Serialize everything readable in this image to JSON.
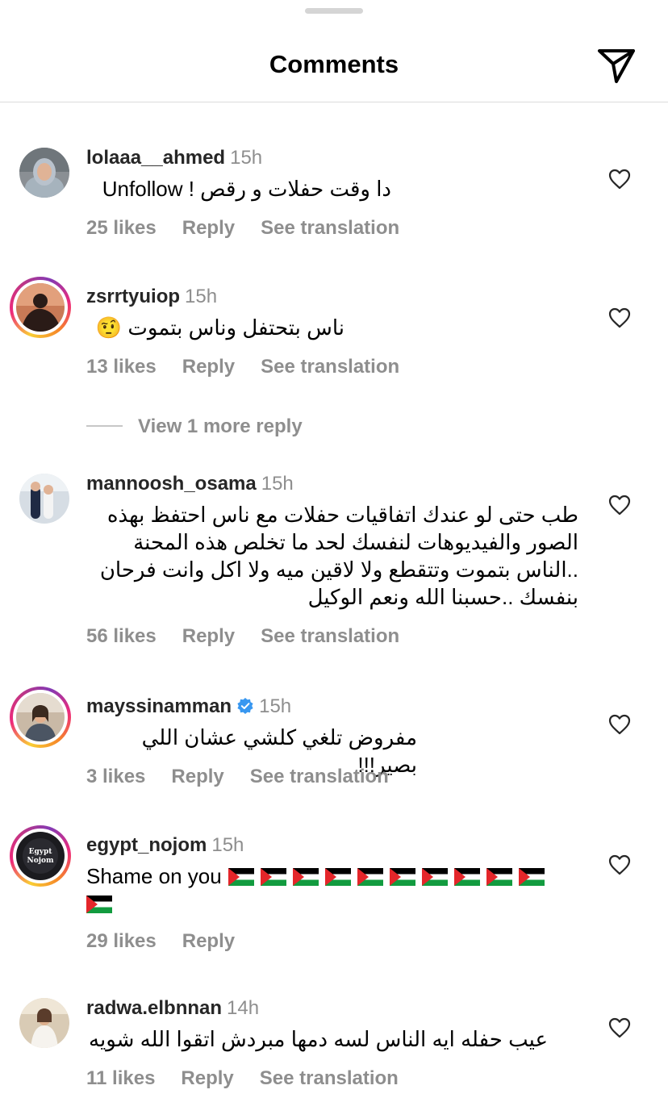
{
  "header": {
    "title": "Comments"
  },
  "comments": [
    {
      "username": "lolaaa__ahmed",
      "time": "15h",
      "text": "دا وقت حفلات و رقص ! Unfollow",
      "likes": "25 likes",
      "reply": "Reply",
      "translate": "See translation"
    },
    {
      "username": "zsrrtyuiop",
      "time": "15h",
      "text": "ناس بتحتفل وناس بتموت 🤨",
      "likes": "13 likes",
      "reply": "Reply",
      "translate": "See translation"
    },
    {
      "username": "mannoosh_osama",
      "time": "15h",
      "text": "طب حتى لو عندك اتفاقيات حفلات مع ناس احتفظ بهذه الصور والفيديوهات لنفسك لحد ما تخلص هذه المحنة ..الناس بتموت وتتقطع ولا لاقين ميه ولا اكل وانت فرحان بنفسك ..حسبنا الله ونعم الوكيل",
      "likes": "56 likes",
      "reply": "Reply",
      "translate": "See translation"
    },
    {
      "username": "mayssinamman",
      "time": "15h",
      "text": "مفروض تلغي كلشي عشان اللي بصير!!!",
      "likes": "3 likes",
      "reply": "Reply",
      "translate": "See translation"
    },
    {
      "username": "egypt_nojom",
      "time": "15h",
      "text": "Shame on you",
      "likes": "29 likes",
      "reply": "Reply"
    },
    {
      "username": "radwa.elbnnan",
      "time": "14h",
      "text": "عيب حفله ايه الناس لسه دمها مبردش اتقوا الله شويه",
      "likes": "11 likes",
      "reply": "Reply",
      "translate": "See translation"
    }
  ],
  "view_more_replies": "View 1 more reply",
  "colors": {
    "meta_gray": "#8e8e8e",
    "verified_blue": "#3897f0",
    "palestine_red": "#e4262a",
    "palestine_green": "#129b3f"
  },
  "icons": {
    "send": "send-icon",
    "like": "heart-icon",
    "verified": "verified-badge-icon",
    "flag": "palestine-flag-icon"
  }
}
